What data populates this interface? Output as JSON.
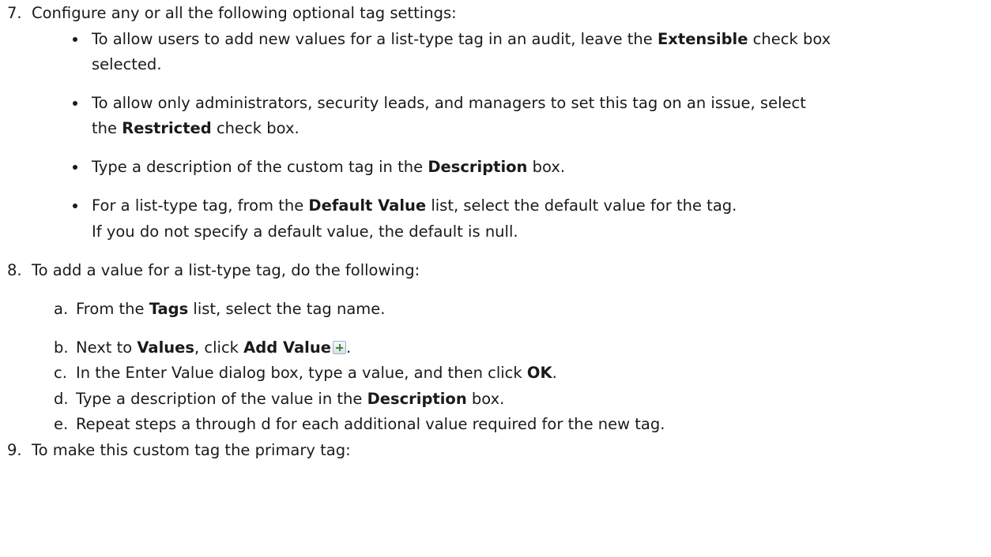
{
  "step7": {
    "number": "7.",
    "text": "Configure any or all the following optional tag settings:",
    "bullets": [
      {
        "pre": "To allow users to add new values for a list-type tag in an audit, leave the ",
        "bold": "Extensible",
        "post": " check box",
        "cont": "selected."
      },
      {
        "pre": "To allow only administrators, security leads, and managers to set this tag on an issue, select",
        "cont_pre": "the ",
        "bold": "Restricted",
        "post": " check box."
      },
      {
        "pre": "Type a description of the custom tag in the ",
        "bold": "Description",
        "post": " box."
      },
      {
        "pre": "For a list-type tag, from the ",
        "bold": "Default Value",
        "post": " list, select the default value for the tag.",
        "cont": "If you do not specify a default value, the default is null."
      }
    ]
  },
  "step8": {
    "number": "8.",
    "text": "To add a value for a list-type tag, do the following:",
    "substeps": [
      {
        "letter": "a.",
        "pre": "From the ",
        "bold": "Tags",
        "post": " list, select the tag name."
      },
      {
        "letter": "b.",
        "pre": "Next to ",
        "bold": "Values",
        "mid": ", click ",
        "bold2": "Add Value",
        "post": "."
      },
      {
        "letter": "c.",
        "pre": "In the Enter Value dialog box, type a value, and then click ",
        "bold": "OK",
        "post": "."
      },
      {
        "letter": "d.",
        "pre": "Type a description of the value in the ",
        "bold": "Description",
        "post": " box."
      },
      {
        "letter": "e.",
        "text": "Repeat steps a through d for each additional value required for the new tag."
      }
    ]
  },
  "step9": {
    "number": "9.",
    "text": "To make this custom tag the primary tag:"
  },
  "icons": {
    "add_value": "add-value-icon"
  }
}
